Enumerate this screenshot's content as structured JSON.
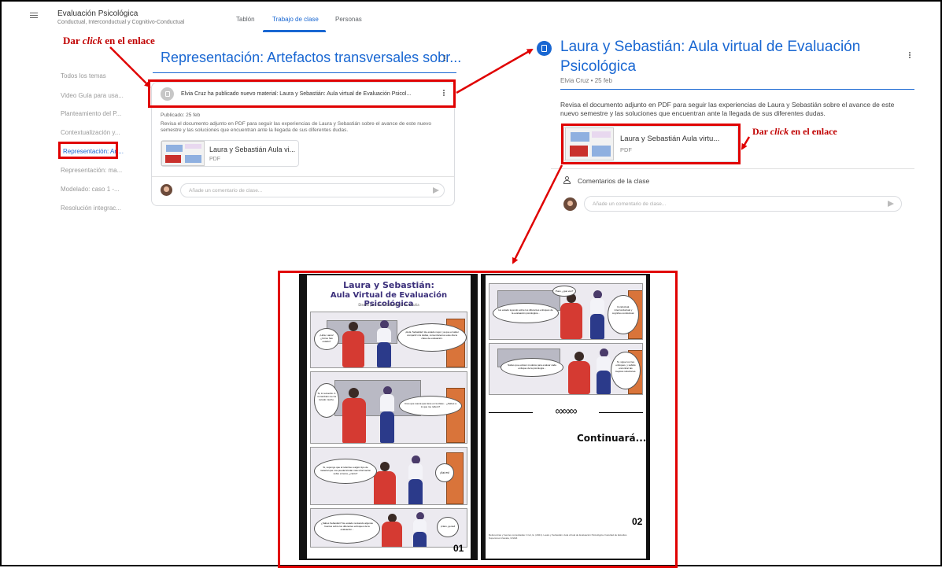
{
  "classroom": {
    "title": "Evaluación Psicológica",
    "subtitle": "Conductual, Interconductual y Cognitivo-Conductual",
    "tabs": [
      {
        "label": "Tablón",
        "active": false
      },
      {
        "label": "Trabajo de clase",
        "active": true
      },
      {
        "label": "Personas",
        "active": false
      }
    ]
  },
  "annotations": {
    "click_pre": "Dar ",
    "click_word": "click",
    "click_post": " en el enlace"
  },
  "left_panel": {
    "topic_title": "Representación: Artefactos transversales sobr...",
    "nav_items": [
      {
        "label": "Todos los temas",
        "highlighted": false
      },
      {
        "label": "Video Guía para usa...",
        "highlighted": false
      },
      {
        "label": "Planteamiento del P...",
        "highlighted": false
      },
      {
        "label": "Contextualización y...",
        "highlighted": false
      },
      {
        "label": "Representación: Art...",
        "highlighted": true
      },
      {
        "label": "Representación: ma...",
        "highlighted": false
      },
      {
        "label": "Modelado: caso 1 -...",
        "highlighted": false
      },
      {
        "label": "Resolución integrac...",
        "highlighted": false
      }
    ],
    "post_header": "Elvia Cruz ha publicado nuevo material: Laura y Sebastián: Aula virtual de Evaluación Psicol...",
    "published": "Publicado: 25 feb",
    "description": "Revisa el documento adjunto en PDF para seguir las experiencias de Laura y Sebastián sobre el avance de este nuevo semestre y las soluciones que encuentran ante la llegada de sus diferentes dudas.",
    "attachment_title": "Laura y Sebastián Aula vi...",
    "attachment_type": "PDF",
    "comment_placeholder": "Añade un comentario de clase..."
  },
  "right_panel": {
    "title_line1": "Laura y Sebastián: Aula virtual de Evaluación",
    "title_line2": "Psicológica",
    "meta": "Elvia Cruz • 25 feb",
    "description": "Revisa el documento adjunto en PDF para seguir las experiencias de Laura y Sebastián sobre el avance de este nuevo semestre y las soluciones que encuentran ante la llegada de sus diferentes dudas.",
    "attachment_title": "Laura y Sebastián Aula virtu...",
    "attachment_type": "PDF",
    "comments_label": "Comentarios de la clase",
    "comment_placeholder": "Añade un comentario de clase..."
  },
  "comic": {
    "title_line1": "Laura y Sebastián:",
    "title_line2": "Aula Virtual de Evaluación Psicológica",
    "byline": "Diseño por: Elvia Gabriela Cruz Urrutia",
    "page1_number": "01",
    "page2_number": "02",
    "continues": "Continuará...",
    "ornament": "∞∞∞",
    "bubbles_p1": [
      "¡Hola, Laura! ¿Cómo has estado?",
      "¡Hola, Sebastián! He estado mejor, ya que el saber compartir mis dudas, comenzaremos este día la clase de evaluación.",
      "Si, lo recuerdo. A mí también me ha tocado mucho.",
      "Creo que suena que tiene en la clase... ¿Sabes a lo que me refiero?",
      "Si, supongo que al referirse a algún tipo de material que nos pueda brindar más información sobre el tema, ¿cierto?",
      "¡Así es!",
      "¿Sabes Sebastián? He estado revisando algunas fuentes sobre los diferentes enfoques de la evaluación...",
      "¡Claro, genial!"
    ],
    "bubbles_p2": [
      "Pues, ¿qué ves?",
      "He estado leyendo sobre los diferentes enfoques de la evaluación psicológica...",
      "Conductual, interconductual y cognitivo-conductual.",
      "Sabes que existen modelos para evaluar cada enfoque de la psicología...",
      "Sí, sigue los tres enfoques, y sabrás encontrar las mejores soluciones."
    ],
    "footer_refs": "Referencias y fuentes consultadas: Cruz, E. (2021). Laura y Sebastián: Aula virtual de Evaluación Psicológica. Facultad de Estudios Superiores Iztacala, UNAM."
  },
  "colors": {
    "accent": "#1967d2",
    "annotation_red": "#e00000",
    "comic_title": "#3a2e7a"
  }
}
